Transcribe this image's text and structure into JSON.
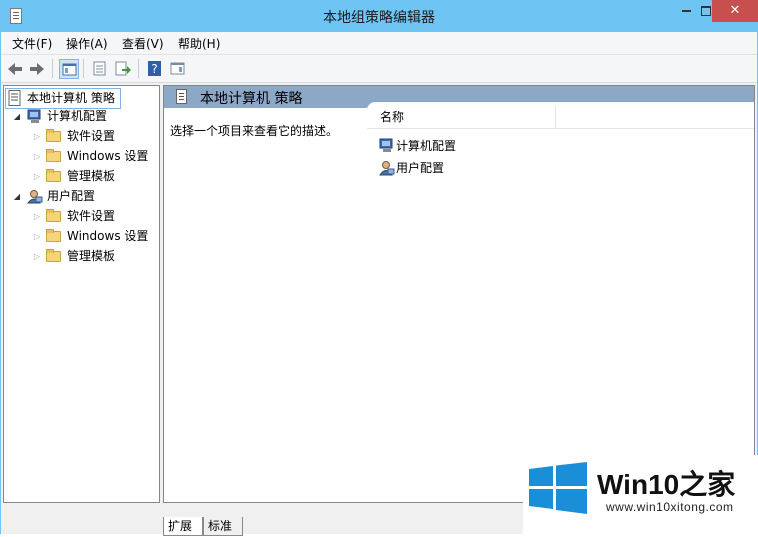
{
  "window": {
    "title": "本地组策略编辑器"
  },
  "menubar": {
    "items": [
      "文件(F)",
      "操作(A)",
      "查看(V)",
      "帮助(H)"
    ]
  },
  "tree": {
    "root": "本地计算机 策略",
    "computer_config": "计算机配置",
    "user_config": "用户配置",
    "computer_children": [
      "软件设置",
      "Windows 设置",
      "管理模板"
    ],
    "user_children": [
      "软件设置",
      "Windows 设置",
      "管理模板"
    ]
  },
  "content": {
    "header_title": "本地计算机 策略",
    "description": "选择一个项目来查看它的描述。",
    "column_name": "名称",
    "rows": [
      "计算机配置",
      "用户配置"
    ]
  },
  "tabs": [
    "扩展",
    "标准"
  ],
  "watermark": {
    "name": "Win10之家",
    "url": "www.win10xitong.com"
  }
}
